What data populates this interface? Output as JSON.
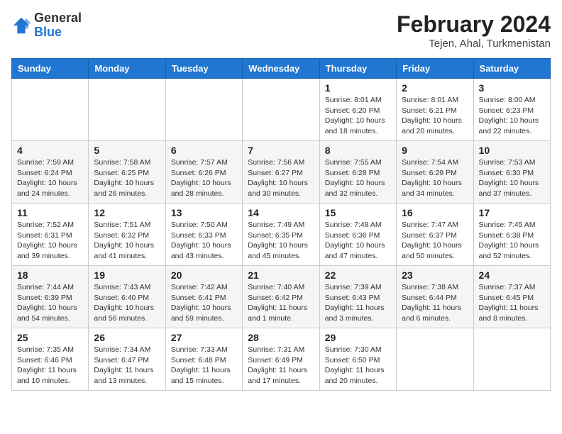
{
  "header": {
    "logo_general": "General",
    "logo_blue": "Blue",
    "month_title": "February 2024",
    "location": "Tejen, Ahal, Turkmenistan"
  },
  "days_of_week": [
    "Sunday",
    "Monday",
    "Tuesday",
    "Wednesday",
    "Thursday",
    "Friday",
    "Saturday"
  ],
  "weeks": [
    [
      {
        "num": "",
        "info": ""
      },
      {
        "num": "",
        "info": ""
      },
      {
        "num": "",
        "info": ""
      },
      {
        "num": "",
        "info": ""
      },
      {
        "num": "1",
        "info": "Sunrise: 8:01 AM\nSunset: 6:20 PM\nDaylight: 10 hours\nand 18 minutes."
      },
      {
        "num": "2",
        "info": "Sunrise: 8:01 AM\nSunset: 6:21 PM\nDaylight: 10 hours\nand 20 minutes."
      },
      {
        "num": "3",
        "info": "Sunrise: 8:00 AM\nSunset: 6:23 PM\nDaylight: 10 hours\nand 22 minutes."
      }
    ],
    [
      {
        "num": "4",
        "info": "Sunrise: 7:59 AM\nSunset: 6:24 PM\nDaylight: 10 hours\nand 24 minutes."
      },
      {
        "num": "5",
        "info": "Sunrise: 7:58 AM\nSunset: 6:25 PM\nDaylight: 10 hours\nand 26 minutes."
      },
      {
        "num": "6",
        "info": "Sunrise: 7:57 AM\nSunset: 6:26 PM\nDaylight: 10 hours\nand 28 minutes."
      },
      {
        "num": "7",
        "info": "Sunrise: 7:56 AM\nSunset: 6:27 PM\nDaylight: 10 hours\nand 30 minutes."
      },
      {
        "num": "8",
        "info": "Sunrise: 7:55 AM\nSunset: 6:28 PM\nDaylight: 10 hours\nand 32 minutes."
      },
      {
        "num": "9",
        "info": "Sunrise: 7:54 AM\nSunset: 6:29 PM\nDaylight: 10 hours\nand 34 minutes."
      },
      {
        "num": "10",
        "info": "Sunrise: 7:53 AM\nSunset: 6:30 PM\nDaylight: 10 hours\nand 37 minutes."
      }
    ],
    [
      {
        "num": "11",
        "info": "Sunrise: 7:52 AM\nSunset: 6:31 PM\nDaylight: 10 hours\nand 39 minutes."
      },
      {
        "num": "12",
        "info": "Sunrise: 7:51 AM\nSunset: 6:32 PM\nDaylight: 10 hours\nand 41 minutes."
      },
      {
        "num": "13",
        "info": "Sunrise: 7:50 AM\nSunset: 6:33 PM\nDaylight: 10 hours\nand 43 minutes."
      },
      {
        "num": "14",
        "info": "Sunrise: 7:49 AM\nSunset: 6:35 PM\nDaylight: 10 hours\nand 45 minutes."
      },
      {
        "num": "15",
        "info": "Sunrise: 7:48 AM\nSunset: 6:36 PM\nDaylight: 10 hours\nand 47 minutes."
      },
      {
        "num": "16",
        "info": "Sunrise: 7:47 AM\nSunset: 6:37 PM\nDaylight: 10 hours\nand 50 minutes."
      },
      {
        "num": "17",
        "info": "Sunrise: 7:45 AM\nSunset: 6:38 PM\nDaylight: 10 hours\nand 52 minutes."
      }
    ],
    [
      {
        "num": "18",
        "info": "Sunrise: 7:44 AM\nSunset: 6:39 PM\nDaylight: 10 hours\nand 54 minutes."
      },
      {
        "num": "19",
        "info": "Sunrise: 7:43 AM\nSunset: 6:40 PM\nDaylight: 10 hours\nand 56 minutes."
      },
      {
        "num": "20",
        "info": "Sunrise: 7:42 AM\nSunset: 6:41 PM\nDaylight: 10 hours\nand 59 minutes."
      },
      {
        "num": "21",
        "info": "Sunrise: 7:40 AM\nSunset: 6:42 PM\nDaylight: 11 hours\nand 1 minute."
      },
      {
        "num": "22",
        "info": "Sunrise: 7:39 AM\nSunset: 6:43 PM\nDaylight: 11 hours\nand 3 minutes."
      },
      {
        "num": "23",
        "info": "Sunrise: 7:38 AM\nSunset: 6:44 PM\nDaylight: 11 hours\nand 6 minutes."
      },
      {
        "num": "24",
        "info": "Sunrise: 7:37 AM\nSunset: 6:45 PM\nDaylight: 11 hours\nand 8 minutes."
      }
    ],
    [
      {
        "num": "25",
        "info": "Sunrise: 7:35 AM\nSunset: 6:46 PM\nDaylight: 11 hours\nand 10 minutes."
      },
      {
        "num": "26",
        "info": "Sunrise: 7:34 AM\nSunset: 6:47 PM\nDaylight: 11 hours\nand 13 minutes."
      },
      {
        "num": "27",
        "info": "Sunrise: 7:33 AM\nSunset: 6:48 PM\nDaylight: 11 hours\nand 15 minutes."
      },
      {
        "num": "28",
        "info": "Sunrise: 7:31 AM\nSunset: 6:49 PM\nDaylight: 11 hours\nand 17 minutes."
      },
      {
        "num": "29",
        "info": "Sunrise: 7:30 AM\nSunset: 6:50 PM\nDaylight: 11 hours\nand 20 minutes."
      },
      {
        "num": "",
        "info": ""
      },
      {
        "num": "",
        "info": ""
      }
    ]
  ]
}
